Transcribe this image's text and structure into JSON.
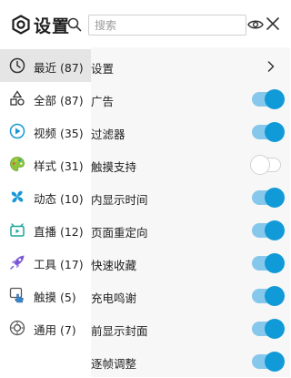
{
  "header": {
    "title": "设置",
    "search_placeholder": "搜索"
  },
  "sidebar": {
    "items": [
      {
        "label": "最近 (87)",
        "icon": "clock-icon",
        "active": true
      },
      {
        "label": "全部 (87)",
        "icon": "shapes-icon",
        "active": false
      },
      {
        "label": "视频 (35)",
        "icon": "play-circle-icon",
        "active": false
      },
      {
        "label": "样式 (31)",
        "icon": "palette-icon",
        "active": false
      },
      {
        "label": "动态 (10)",
        "icon": "pinwheel-icon",
        "active": false
      },
      {
        "label": "直播 (12)",
        "icon": "live-tv-icon",
        "active": false
      },
      {
        "label": "工具 (17)",
        "icon": "rocket-icon",
        "active": false
      },
      {
        "label": "触摸 (5)",
        "icon": "touch-icon",
        "active": false
      },
      {
        "label": "通用 (7)",
        "icon": "gear-icon",
        "active": false
      }
    ]
  },
  "settings": {
    "rows": [
      {
        "label": "设置",
        "control": "chevron"
      },
      {
        "label": "广告",
        "control": "toggle",
        "on": true
      },
      {
        "label": "过滤器",
        "control": "toggle",
        "on": true
      },
      {
        "label": "触摸支持",
        "control": "toggle",
        "on": false
      },
      {
        "label": "内显示时间",
        "control": "toggle",
        "on": true
      },
      {
        "label": "页面重定向",
        "control": "toggle",
        "on": true
      },
      {
        "label": "快速收藏",
        "control": "toggle",
        "on": true
      },
      {
        "label": "充电鸣谢",
        "control": "toggle",
        "on": true
      },
      {
        "label": "前显示封面",
        "control": "toggle",
        "on": true
      },
      {
        "label": "逐帧调整",
        "control": "toggle",
        "on": true
      }
    ]
  },
  "colors": {
    "accent": "#119ad8",
    "accent_track": "#86c8ec",
    "active_bg": "#e5e5e5"
  }
}
